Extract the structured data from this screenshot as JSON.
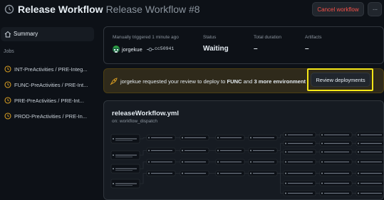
{
  "header": {
    "title": "Release Workflow",
    "run_label": "Release Workflow #8",
    "cancel_label": "Cancel workflow",
    "more_label": "···"
  },
  "sidebar": {
    "summary_label": "Summary",
    "jobs_heading": "Jobs",
    "jobs": [
      {
        "label": "INT-PreActivities / PRE-Integ..."
      },
      {
        "label": "FUNC-PreActivities / PRE-Int..."
      },
      {
        "label": "PRE-PreActivities / PRE-Int..."
      },
      {
        "label": "PROD-PreActivities / PRE-In..."
      }
    ]
  },
  "summary": {
    "trigger_label": "Manually triggered 1 minute ago",
    "actor": "jorgekue",
    "commit": "cc50941",
    "status_label": "Status",
    "status_value": "Waiting",
    "duration_label": "Total duration",
    "duration_value": "–",
    "artifacts_label": "Artifacts",
    "artifacts_value": "–"
  },
  "banner": {
    "actor": "jorgekue",
    "text_mid": " requested your review to deploy to ",
    "env": "FUNC",
    "text_and": " and ",
    "more": "3 more environment",
    "review_label": "Review deployments"
  },
  "graph": {
    "workflow_file": "releaseWorkflow.yml",
    "trigger": "on: workflow_dispatch"
  },
  "colors": {
    "background": "#0d1117",
    "accent_red": "#f85149",
    "waiting_yellow": "#d29922",
    "highlight": "#f5e717"
  }
}
